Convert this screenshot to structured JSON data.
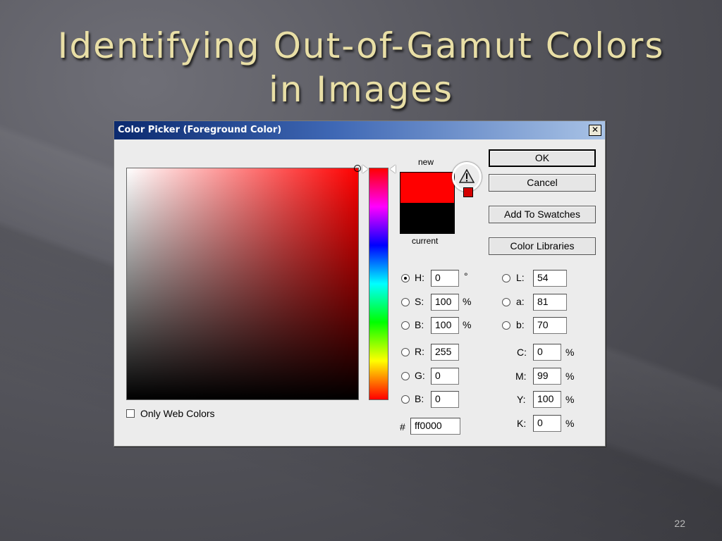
{
  "slide": {
    "title_line1": "Identifying Out-of-Gamut Colors",
    "title_line2": "in Images",
    "page_number": "22"
  },
  "dialog": {
    "title": "Color Picker (Foreground Color)",
    "close_glyph": "✕",
    "new_label": "new",
    "current_label": "current",
    "new_color": "#ff0000",
    "current_color": "#000000",
    "buttons": {
      "ok": "OK",
      "cancel": "Cancel",
      "add_swatches": "Add To Swatches",
      "color_libraries": "Color Libraries"
    },
    "hsb": {
      "h_label": "H:",
      "h_value": "0",
      "h_unit": "°",
      "s_label": "S:",
      "s_value": "100",
      "s_unit": "%",
      "b_label": "B:",
      "b_value": "100",
      "b_unit": "%"
    },
    "rgb": {
      "r_label": "R:",
      "r_value": "255",
      "g_label": "G:",
      "g_value": "0",
      "b_label": "B:",
      "b_value": "0"
    },
    "lab": {
      "l_label": "L:",
      "l_value": "54",
      "a_label": "a:",
      "a_value": "81",
      "b_label": "b:",
      "b_value": "70"
    },
    "cmyk": {
      "c_label": "C:",
      "c_value": "0",
      "c_unit": "%",
      "m_label": "M:",
      "m_value": "99",
      "m_unit": "%",
      "y_label": "Y:",
      "y_value": "100",
      "y_unit": "%",
      "k_label": "K:",
      "k_value": "0",
      "k_unit": "%"
    },
    "hex": {
      "label": "#",
      "value": "ff0000"
    },
    "only_web_colors": "Only Web Colors",
    "icons": {
      "gamut_warning": "warning-triangle-icon"
    }
  }
}
